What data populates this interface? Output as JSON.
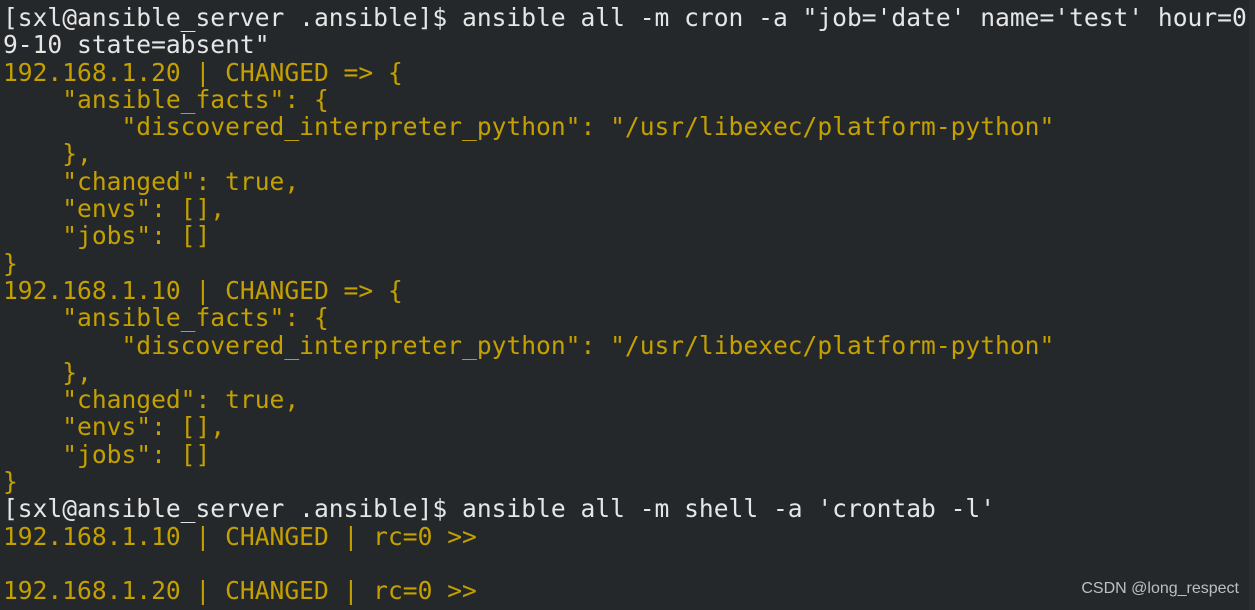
{
  "colors": {
    "background": "#24282b",
    "prompt_text": "#e6e6e6",
    "output_text": "#c4a000"
  },
  "lines": [
    {
      "text": "[sxl@ansible_server .ansible]$ ansible all -m cron -a \"job='date' name='test' hour=0",
      "style": "w"
    },
    {
      "text": "9-10 state=absent\"",
      "style": "w"
    },
    {
      "text": "192.168.1.20 | CHANGED => {",
      "style": "y"
    },
    {
      "text": "    \"ansible_facts\": {",
      "style": "y"
    },
    {
      "text": "        \"discovered_interpreter_python\": \"/usr/libexec/platform-python\"",
      "style": "y"
    },
    {
      "text": "    },",
      "style": "y"
    },
    {
      "text": "    \"changed\": true,",
      "style": "y"
    },
    {
      "text": "    \"envs\": [],",
      "style": "y"
    },
    {
      "text": "    \"jobs\": []",
      "style": "y"
    },
    {
      "text": "}",
      "style": "y"
    },
    {
      "text": "192.168.1.10 | CHANGED => {",
      "style": "y"
    },
    {
      "text": "    \"ansible_facts\": {",
      "style": "y"
    },
    {
      "text": "        \"discovered_interpreter_python\": \"/usr/libexec/platform-python\"",
      "style": "y"
    },
    {
      "text": "    },",
      "style": "y"
    },
    {
      "text": "    \"changed\": true,",
      "style": "y"
    },
    {
      "text": "    \"envs\": [],",
      "style": "y"
    },
    {
      "text": "    \"jobs\": []",
      "style": "y"
    },
    {
      "text": "}",
      "style": "y"
    },
    {
      "text": "[sxl@ansible_server .ansible]$ ansible all -m shell -a 'crontab -l'",
      "style": "w"
    },
    {
      "text": "192.168.1.10 | CHANGED | rc=0 >>",
      "style": "y"
    },
    {
      "text": "",
      "style": "y"
    },
    {
      "text": "192.168.1.20 | CHANGED | rc=0 >>",
      "style": "y"
    }
  ],
  "watermark": "CSDN @long_respect"
}
